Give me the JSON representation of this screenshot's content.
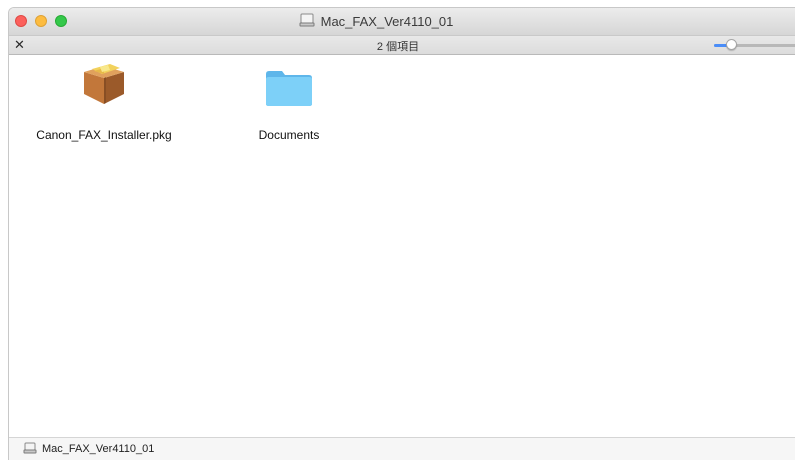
{
  "window": {
    "title": "Mac_FAX_Ver4110_01",
    "title_icon": "disk-image-icon"
  },
  "toolbar": {
    "tools_icon": "tools-icon",
    "tools_glyph": "✕",
    "item_count": "2 個項目",
    "icon_size_slider_level": 0.15
  },
  "files": [
    {
      "name": "Canon_FAX_Installer.pkg",
      "icon": "package-icon"
    },
    {
      "name": "Documents",
      "icon": "folder-icon"
    }
  ],
  "path_bar": {
    "label": "Mac_FAX_Ver4110_01",
    "icon": "disk-image-icon"
  },
  "colors": {
    "close": "#fc605c",
    "minimize": "#fdbc40",
    "zoom": "#34c84a",
    "folder": "#6ec8f6",
    "slider_accent": "#4a8df8"
  }
}
